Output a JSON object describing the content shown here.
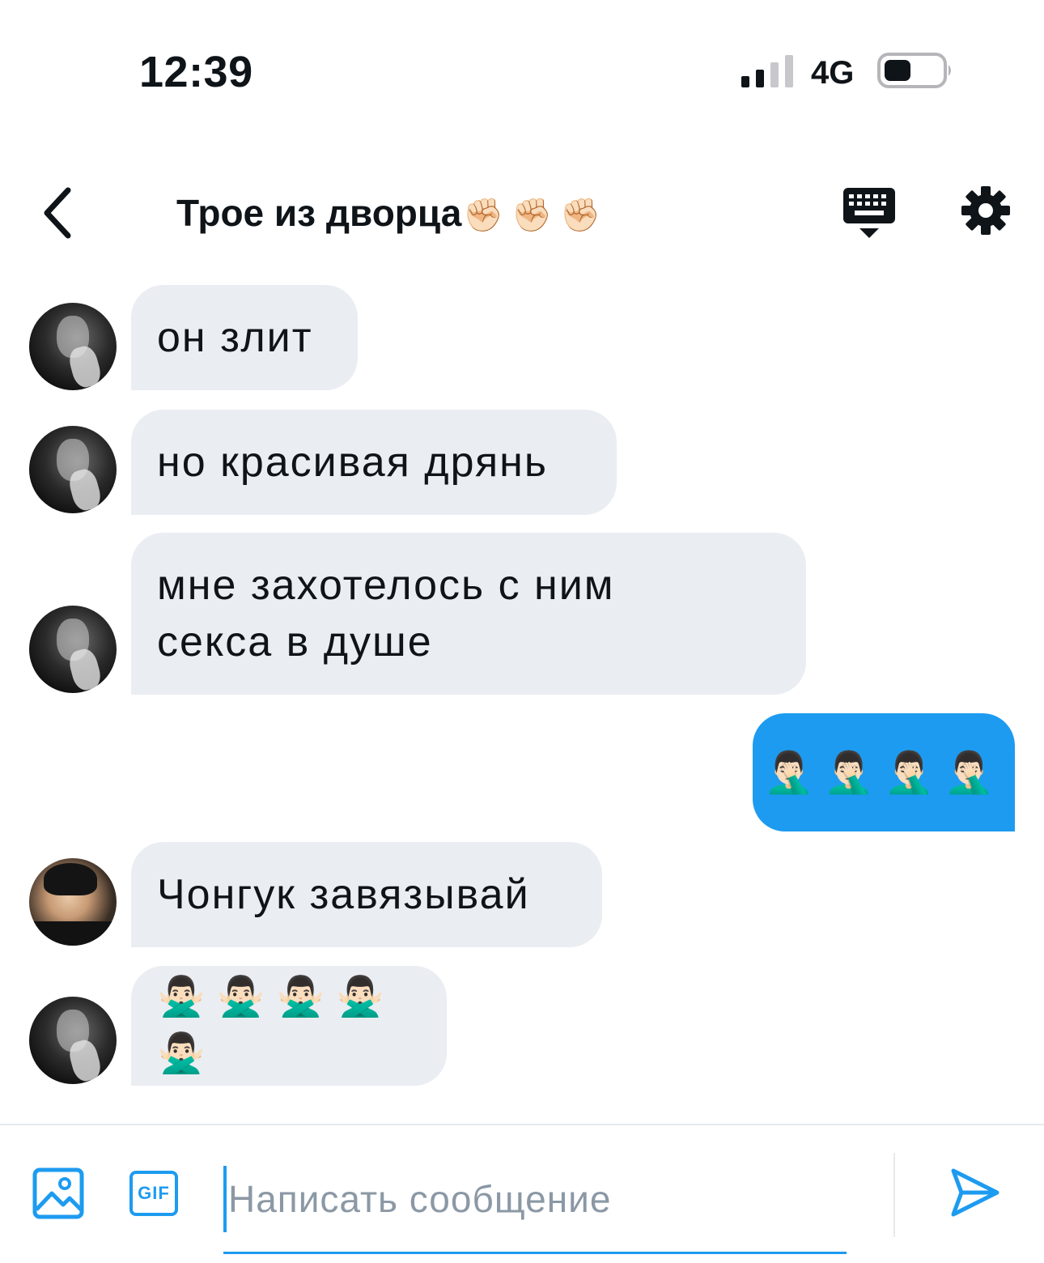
{
  "status_bar": {
    "time": "12:39",
    "network": "4G"
  },
  "header": {
    "back_icon": "chevron-left-icon",
    "title": "Трое из дворца",
    "title_emoji": "✊🏻✊🏻✊🏻",
    "keyboard_icon": "keyboard-icon",
    "settings_icon": "gear-icon"
  },
  "messages": [
    {
      "direction": "incoming",
      "sender_avatar": "avatar-dark",
      "text": "он злит"
    },
    {
      "direction": "incoming",
      "sender_avatar": "avatar-dark",
      "text": "но красивая дрянь"
    },
    {
      "direction": "incoming",
      "sender_avatar": "avatar-dark",
      "text": "мне захотелось с ним\nсекса в душе"
    },
    {
      "direction": "outgoing",
      "text": "🤦🏻‍♂️🤦🏻‍♂️🤦🏻‍♂️🤦🏻‍♂️"
    },
    {
      "direction": "incoming",
      "sender_avatar": "avatar-color",
      "text": "Чонгук завязывай"
    },
    {
      "direction": "incoming",
      "sender_avatar": "avatar-dark",
      "text": "🙅🏻‍♂️🙅🏻‍♂️🙅🏻‍♂️🙅🏻‍♂️🙅🏻‍♂️"
    }
  ],
  "composer": {
    "image_icon": "image-icon",
    "gif_label": "GIF",
    "placeholder": "Написать сообщение",
    "value": "",
    "send_icon": "send-icon"
  },
  "colors": {
    "accent": "#1d9bf0",
    "incoming_bubble": "#eaedf2",
    "text": "#0f1419",
    "placeholder": "#8b98a5"
  }
}
